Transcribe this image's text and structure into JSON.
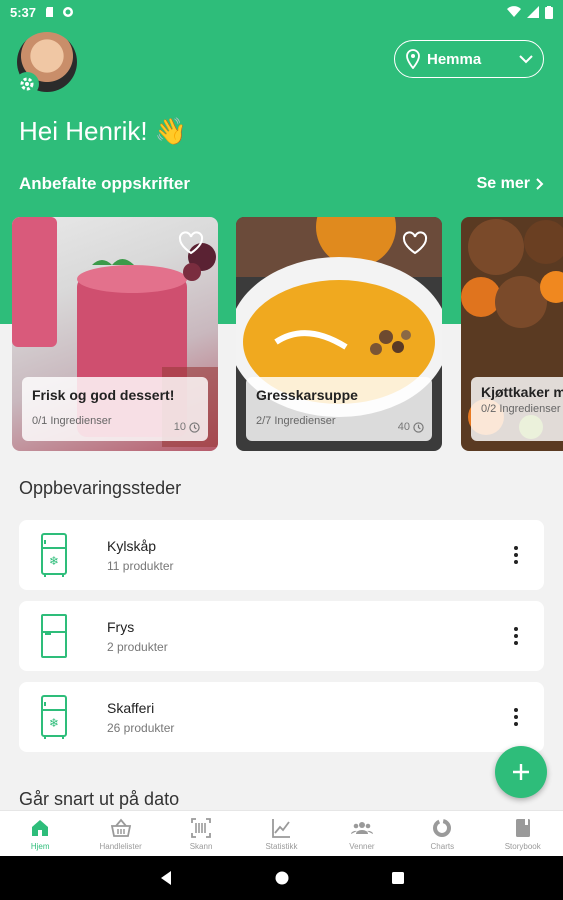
{
  "status_bar": {
    "time": "5:37"
  },
  "header": {
    "location_label": "Hemma",
    "greeting": "Hei Henrik! 👋"
  },
  "recommended": {
    "title": "Anbefalte oppskrifter",
    "see_more": "Se mer",
    "recipes": [
      {
        "name": "Frisk og god dessert!",
        "ingredients": "0/1 Ingredienser",
        "minutes": "10"
      },
      {
        "name": "Gresskarsuppe",
        "ingredients": "2/7 Ingredienser",
        "minutes": "40"
      },
      {
        "name": "Kjøttkaker med grønnsaksris",
        "ingredients": "0/2 Ingredienser",
        "minutes": ""
      }
    ]
  },
  "storage": {
    "title": "Oppbevaringssteder",
    "items": [
      {
        "name": "Kylskåp",
        "count": "11 produkter"
      },
      {
        "name": "Frys",
        "count": "2 produkter"
      },
      {
        "name": "Skafferi",
        "count": "26 produkter"
      }
    ]
  },
  "expiring": {
    "title": "Går snart ut på dato"
  },
  "nav": [
    {
      "label": "Hjem",
      "icon": "home-icon",
      "active": true
    },
    {
      "label": "Handlelister",
      "icon": "basket-icon"
    },
    {
      "label": "Skann",
      "icon": "barcode-icon"
    },
    {
      "label": "Statistikk",
      "icon": "chart-icon"
    },
    {
      "label": "Venner",
      "icon": "people-icon"
    },
    {
      "label": "Charts",
      "icon": "donut-icon"
    },
    {
      "label": "Storybook",
      "icon": "book-icon"
    }
  ],
  "colors": {
    "brand": "#2ebd7a",
    "background": "#f2f2f2"
  }
}
